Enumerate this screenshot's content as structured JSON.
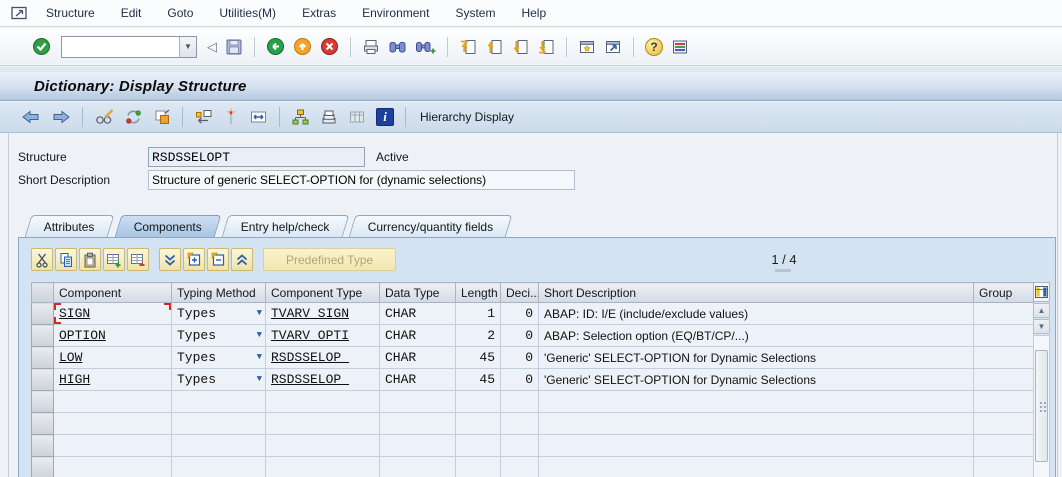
{
  "window": {
    "menu": {
      "items": [
        "Structure",
        "Edit",
        "Goto",
        "Utilities(M)",
        "Extras",
        "Environment",
        "System",
        "Help"
      ]
    }
  },
  "toolbar": {
    "command_field": {
      "value": "",
      "placeholder": ""
    }
  },
  "screen": {
    "title": "Dictionary: Display Structure",
    "app_toolbar": {
      "hierarchy_display": "Hierarchy Display"
    }
  },
  "form": {
    "structure": {
      "label": "Structure",
      "value": "RSDSSELOPT",
      "status": "Active"
    },
    "short_description": {
      "label": "Short Description",
      "value": "Structure of generic SELECT-OPTION for (dynamic selections)"
    }
  },
  "tabs": {
    "items": [
      {
        "label": "Attributes",
        "active": false
      },
      {
        "label": "Components",
        "active": true
      },
      {
        "label": "Entry help/check",
        "active": false
      },
      {
        "label": "Currency/quantity fields",
        "active": false
      }
    ]
  },
  "components": {
    "toolbar": {
      "predefined_type": "Predefined Type",
      "position": "1 / 4"
    },
    "table": {
      "columns": [
        "Component",
        "Typing Method",
        "Component Type",
        "Data Type",
        "Length",
        "Deci...",
        "Short Description",
        "Group"
      ],
      "rows": [
        {
          "component": "SIGN",
          "typing_method": "Types",
          "component_type": "TVARV_SIGN",
          "data_type": "CHAR",
          "length": "1",
          "decimals": "0",
          "short_description": "ABAP: ID: I/E (include/exclude values)",
          "group": ""
        },
        {
          "component": "OPTION",
          "typing_method": "Types",
          "component_type": "TVARV_OPTI",
          "data_type": "CHAR",
          "length": "2",
          "decimals": "0",
          "short_description": "ABAP: Selection option (EQ/BT/CP/...)",
          "group": ""
        },
        {
          "component": "LOW",
          "typing_method": "Types",
          "component_type": "RSDSSELOP_",
          "data_type": "CHAR",
          "length": "45",
          "decimals": "0",
          "short_description": "'Generic' SELECT-OPTION for Dynamic Selections",
          "group": ""
        },
        {
          "component": "HIGH",
          "typing_method": "Types",
          "component_type": "RSDSSELOP_",
          "data_type": "CHAR",
          "length": "45",
          "decimals": "0",
          "short_description": "'Generic' SELECT-OPTION for Dynamic Selections",
          "group": ""
        }
      ],
      "empty_rows": 4
    }
  },
  "icons": {
    "dropdown": "▼",
    "collapse": "◁",
    "scroll_up": "▲",
    "scroll_down": "▼",
    "help": "?",
    "info": "i"
  },
  "colors": {
    "title_gradient_bottom": "#b5c8df",
    "panel_blue": "#d4e3f2",
    "button_yellow": "#f1e3a6",
    "cursor_red": "#d42a1e",
    "link_underline": "#000000"
  }
}
